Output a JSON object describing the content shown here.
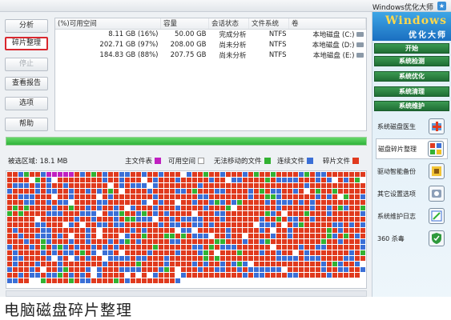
{
  "window": {
    "title": "Windows优化大师"
  },
  "left_buttons": [
    {
      "label": "分析",
      "state": "normal"
    },
    {
      "label": "碎片整理",
      "state": "active"
    },
    {
      "label": "停止",
      "state": "disabled"
    },
    {
      "label": "查看报告",
      "state": "normal"
    },
    {
      "label": "选项",
      "state": "normal"
    },
    {
      "label": "帮助",
      "state": "normal"
    }
  ],
  "volumes": {
    "headers": [
      "卷",
      "文件系统",
      "会话状态",
      "容量",
      "可用空间(%)"
    ],
    "rows": [
      {
        "volume": "本地磁盘 (C:)",
        "fs": "NTFS",
        "status": "完成分析",
        "capacity": "50.00 GB",
        "free": "8.11 GB (16%)"
      },
      {
        "volume": "本地磁盘 (D:)",
        "fs": "NTFS",
        "status": "尚未分析",
        "capacity": "208.00 GB",
        "free": "202.71 GB (97%)"
      },
      {
        "volume": "本地磁盘 (E:)",
        "fs": "NTFS",
        "status": "尚未分析",
        "capacity": "207.75 GB",
        "free": "184.83 GB (88%)"
      }
    ]
  },
  "progress": {
    "percent": 100,
    "color": "#2fb33a"
  },
  "legend": {
    "selected_area": "被选区域: 18.1 MB",
    "items": [
      {
        "label": "碎片文件",
        "color": "#e03a1e"
      },
      {
        "label": "连续文件",
        "color": "#3b6fd6"
      },
      {
        "label": "无法移动的文件",
        "color": "#33b233"
      },
      {
        "label": "可用空间",
        "color": "#ffffff"
      },
      {
        "label": "主文件表",
        "color": "#c020c0"
      }
    ]
  },
  "block_map": {
    "description_colors": {
      "fragmented": "#e03a1e",
      "contiguous": "#3b6fd6",
      "unmovable": "#33b233",
      "free": "#ffffff",
      "mft": "#c020c0"
    }
  },
  "right_panel": {
    "brand_line1": "Windows",
    "brand_line2": "优化大师",
    "nav": [
      "开始",
      "系统检测",
      "系统优化",
      "系统清理",
      "系统维护"
    ],
    "items": [
      {
        "label": "系统磁盘医生",
        "icon": "disk-doctor-icon"
      },
      {
        "label": "磁盘碎片整理",
        "icon": "defrag-icon",
        "active": true
      },
      {
        "label": "驱动智能备份",
        "icon": "driver-backup-icon"
      },
      {
        "label": "其它设置选项",
        "icon": "settings-icon"
      },
      {
        "label": "系统维护日志",
        "icon": "log-icon"
      },
      {
        "label": "360 杀毒",
        "icon": "shield-icon"
      }
    ]
  },
  "caption": "电脑磁盘碎片整理"
}
